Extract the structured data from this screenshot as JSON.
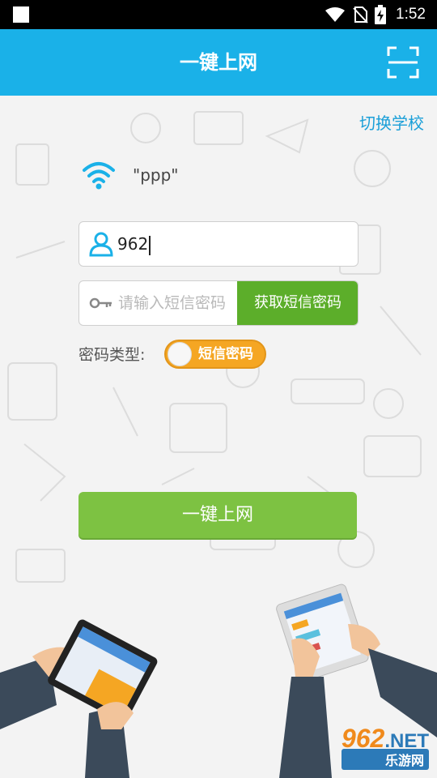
{
  "status_bar": {
    "time": "1:52",
    "icons": [
      "notification-square-icon",
      "wifi-icon",
      "no-sim-icon",
      "battery-charging-icon"
    ]
  },
  "app_bar": {
    "title": "一键上网",
    "scan_icon": "scan-icon"
  },
  "top_link": {
    "switch_school": "切换学校"
  },
  "network": {
    "ssid": "\"ppp\"",
    "icon": "wifi-icon",
    "icon_color": "#1ab1e8"
  },
  "form": {
    "username_value": "962",
    "sms_password_placeholder": "请输入短信密码",
    "get_sms_button": "获取短信密码",
    "password_type_label": "密码类型:",
    "password_type_toggle": "短信密码",
    "submit_button": "一键上网"
  },
  "watermark": {
    "main": "962",
    "net": ".NET",
    "sub": "乐游网"
  },
  "colors": {
    "accent": "#1ab1e8",
    "sms_button": "#5cae2a",
    "submit_button": "#7dc242",
    "toggle": "#f5a623"
  }
}
